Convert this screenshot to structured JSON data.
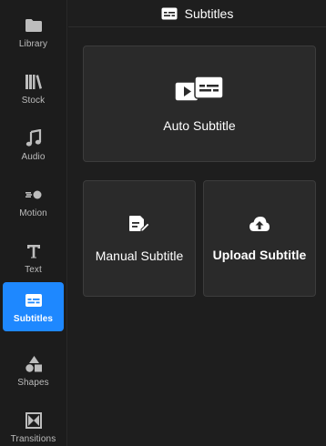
{
  "sidebar": {
    "items": [
      {
        "label": "Library",
        "icon": "folder-icon"
      },
      {
        "label": "Stock",
        "icon": "books-icon"
      },
      {
        "label": "Audio",
        "icon": "music-note-icon"
      },
      {
        "label": "Motion",
        "icon": "motion-icon"
      },
      {
        "label": "Text",
        "icon": "text-icon"
      },
      {
        "label": "Subtitles",
        "icon": "subtitles-icon",
        "active": true
      },
      {
        "label": "Shapes",
        "icon": "shapes-icon"
      },
      {
        "label": "Transitions",
        "icon": "transitions-icon"
      }
    ]
  },
  "header": {
    "title": "Subtitles",
    "icon": "subtitles-icon"
  },
  "cards": {
    "auto": {
      "label": "Auto Subtitle",
      "icon": "auto-subtitle-icon"
    },
    "manual": {
      "label": "Manual Subtitle",
      "icon": "edit-document-icon"
    },
    "upload": {
      "label": "Upload Subtitle",
      "icon": "cloud-upload-icon"
    }
  },
  "colors": {
    "accent": "#1e88ff",
    "background": "#1c1c1c",
    "card": "#2a2a2a"
  }
}
